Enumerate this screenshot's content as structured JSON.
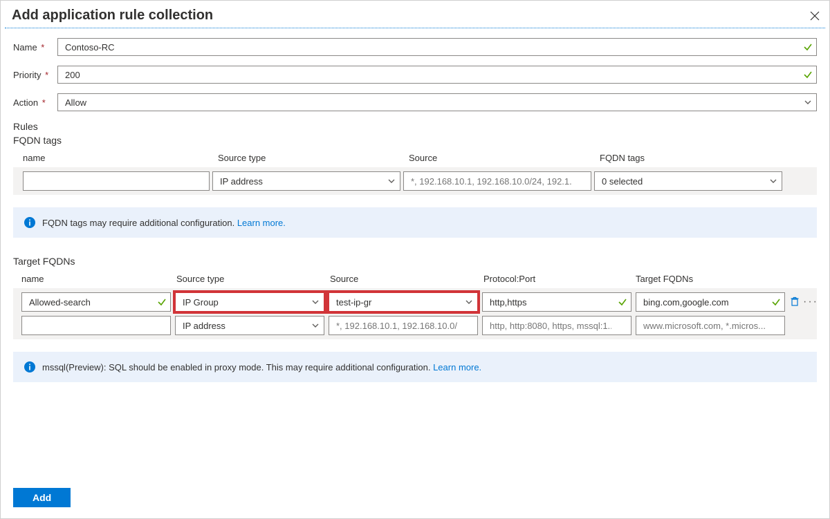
{
  "header": {
    "title": "Add application rule collection"
  },
  "form": {
    "name_label": "Name",
    "name_value": "Contoso-RC",
    "priority_label": "Priority",
    "priority_value": "200",
    "action_label": "Action",
    "action_value": "Allow"
  },
  "rules_label": "Rules",
  "fqdn_tags": {
    "title": "FQDN tags",
    "headers": {
      "name": "name",
      "source_type": "Source type",
      "source": "Source",
      "fqdn_tags": "FQDN tags"
    },
    "row": {
      "name_value": "",
      "source_type_value": "IP address",
      "source_placeholder": "*, 192.168.10.1, 192.168.10.0/24, 192.1...",
      "fqdn_tags_value": "0 selected"
    },
    "info_text": "FQDN tags may require additional configuration. ",
    "info_link": "Learn more."
  },
  "target_fqdns": {
    "title": "Target FQDNs",
    "headers": {
      "name": "name",
      "source_type": "Source type",
      "source": "Source",
      "protocol": "Protocol:Port",
      "targets": "Target FQDNs"
    },
    "rows": [
      {
        "name": "Allowed-search",
        "source_type": "IP Group",
        "source": "test-ip-gr",
        "protocol": "http,https",
        "targets": "bing.com,google.com",
        "highlight": true,
        "valid": true
      },
      {
        "name": "",
        "source_type": "IP address",
        "source_placeholder": "*, 192.168.10.1, 192.168.10.0/...",
        "protocol_placeholder": "http, http:8080, https, mssql:1...",
        "targets_placeholder": "www.microsoft.com, *.micros...",
        "highlight": false,
        "valid": false
      }
    ],
    "info_text": "mssql(Preview): SQL should be enabled in proxy mode. This may require additional configuration. ",
    "info_link": "Learn more."
  },
  "footer": {
    "add_label": "Add"
  }
}
